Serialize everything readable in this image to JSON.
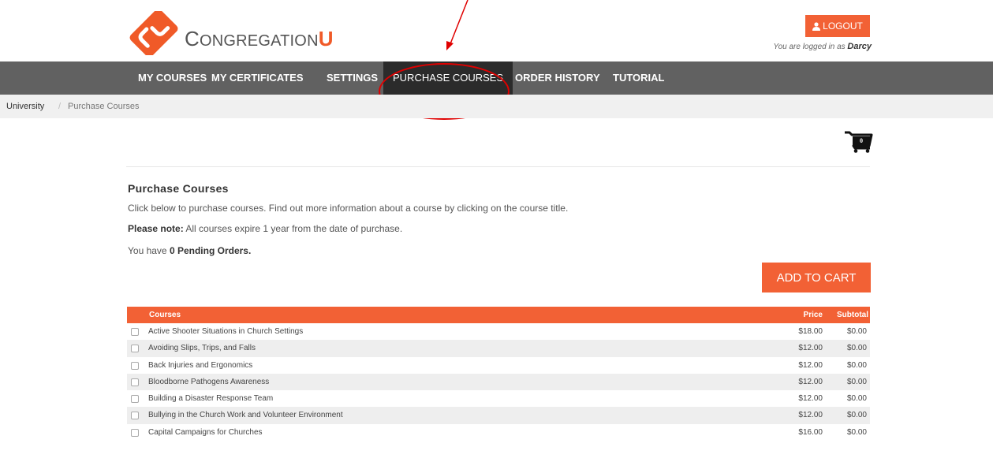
{
  "brand": {
    "name_prefix": "C",
    "name_mid": "ONGREGATION",
    "name_suffix": "U",
    "accent": "#f26135"
  },
  "header": {
    "logout_label": "LOGOUT",
    "logged_in_prefix": "You are logged in as",
    "user": "Darcy"
  },
  "nav": {
    "items": [
      {
        "label": "MY COURSES"
      },
      {
        "label": "MY CERTIFICATES"
      },
      {
        "label": "SETTINGS"
      },
      {
        "label": "PURCHASE COURSES",
        "active": true
      },
      {
        "label": "ORDER HISTORY"
      },
      {
        "label": "TUTORIAL"
      }
    ]
  },
  "breadcrumb": {
    "items": [
      "University",
      "Purchase Courses"
    ],
    "separator": "/"
  },
  "cart": {
    "count": "0",
    "icon": "shopping-cart-icon"
  },
  "main": {
    "heading": "Purchase Courses",
    "intro": "Click below to purchase courses. Find out more information about a course by clicking on the course title.",
    "note_label": "Please note:",
    "note_text": " All courses expire 1 year from the date of purchase.",
    "pending_prefix": "You have ",
    "pending_value": "0 Pending Orders.",
    "add_to_cart_label": "ADD TO CART"
  },
  "table": {
    "headers": {
      "course": "Courses",
      "price": "Price",
      "subtotal": "Subtotal"
    },
    "rows": [
      {
        "title": "Active Shooter Situations in Church Settings",
        "price": "$18.00",
        "subtotal": "$0.00"
      },
      {
        "title": "Avoiding Slips, Trips, and Falls",
        "price": "$12.00",
        "subtotal": "$0.00"
      },
      {
        "title": "Back Injuries and Ergonomics",
        "price": "$12.00",
        "subtotal": "$0.00"
      },
      {
        "title": "Bloodborne Pathogens Awareness",
        "price": "$12.00",
        "subtotal": "$0.00"
      },
      {
        "title": "Building a Disaster Response Team",
        "price": "$12.00",
        "subtotal": "$0.00"
      },
      {
        "title": "Bullying in the Church Work and Volunteer Environment",
        "price": "$12.00",
        "subtotal": "$0.00"
      },
      {
        "title": "Capital Campaigns for Churches",
        "price": "$16.00",
        "subtotal": "$0.00"
      }
    ]
  },
  "annotation": {
    "color": "#e00000"
  }
}
